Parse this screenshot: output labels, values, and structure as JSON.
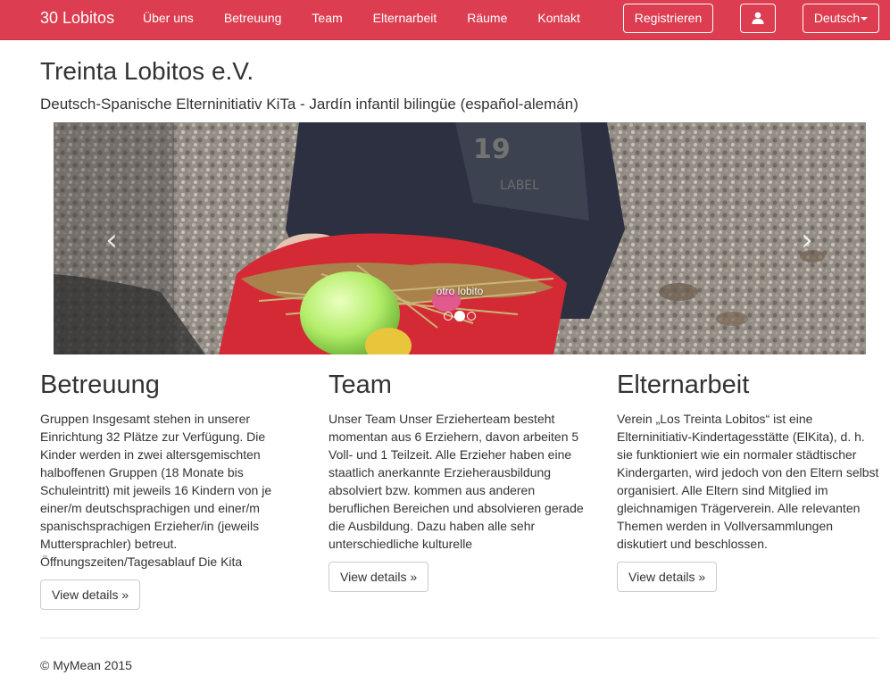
{
  "navbar": {
    "brand": "30 Lobitos",
    "items": [
      "Über uns",
      "Betreuung",
      "Team",
      "Elternarbeit",
      "Räume",
      "Kontakt"
    ],
    "register_label": "Registrieren",
    "user_icon": "user-icon",
    "language_label": "Deutsch",
    "accent_color": "#dc3d50"
  },
  "header": {
    "title": "Treinta Lobitos e.V.",
    "subtitle": "Deutsch-Spanische Elterninitiativ KiTa - Jardín infantil bilingüe (español-alemán)"
  },
  "carousel": {
    "caption": "otro lobito",
    "prev_icon": "chevron-left-icon",
    "next_icon": "chevron-right-icon",
    "prev_glyph": "‹",
    "next_glyph": "›",
    "slide_count": 3,
    "active_slide": 2
  },
  "columns": [
    {
      "heading": "Betreuung",
      "text": "Gruppen Insgesamt stehen in unserer Einrichtung 32 Plätze zur Verfügung. Die Kinder werden in zwei altersgemischten halboffenen Gruppen (18 Monate bis Schuleintritt) mit jeweils 16 Kindern von je einer/m deutschsprachigen und einer/m spanischsprachigen Erzieher/in (jeweils Muttersprachler) betreut. Öffnungszeiten/Tagesablauf Die Kita",
      "button": "View details »"
    },
    {
      "heading": "Team",
      "text": "Unser Team Unser Erzieherteam besteht momentan aus 6 Erziehern, davon arbeiten 5 Voll- und 1 Teilzeit. Alle Erzieher haben eine staatlich anerkannte Erzieherausbildung absolviert bzw. kommen aus anderen beruflichen Bereichen und absolvieren gerade die Ausbildung. Dazu haben alle sehr unterschiedliche kulturelle",
      "button": "View details »"
    },
    {
      "heading": "Elternarbeit",
      "text": "Verein „Los Treinta Lobitos“ ist eine Elterninitiativ-Kindertagesstätte (ElKita), d. h. sie funktioniert wie ein normaler städtischer Kindergarten, wird jedoch von den Eltern selbst organisiert. Alle Eltern sind Mitglied im gleichnamigen Trägerverein. Alle relevanten Themen werden in Vollversammlungen diskutiert und beschlossen.",
      "button": "View details »"
    }
  ],
  "footer": {
    "text": "© MyMean 2015"
  }
}
